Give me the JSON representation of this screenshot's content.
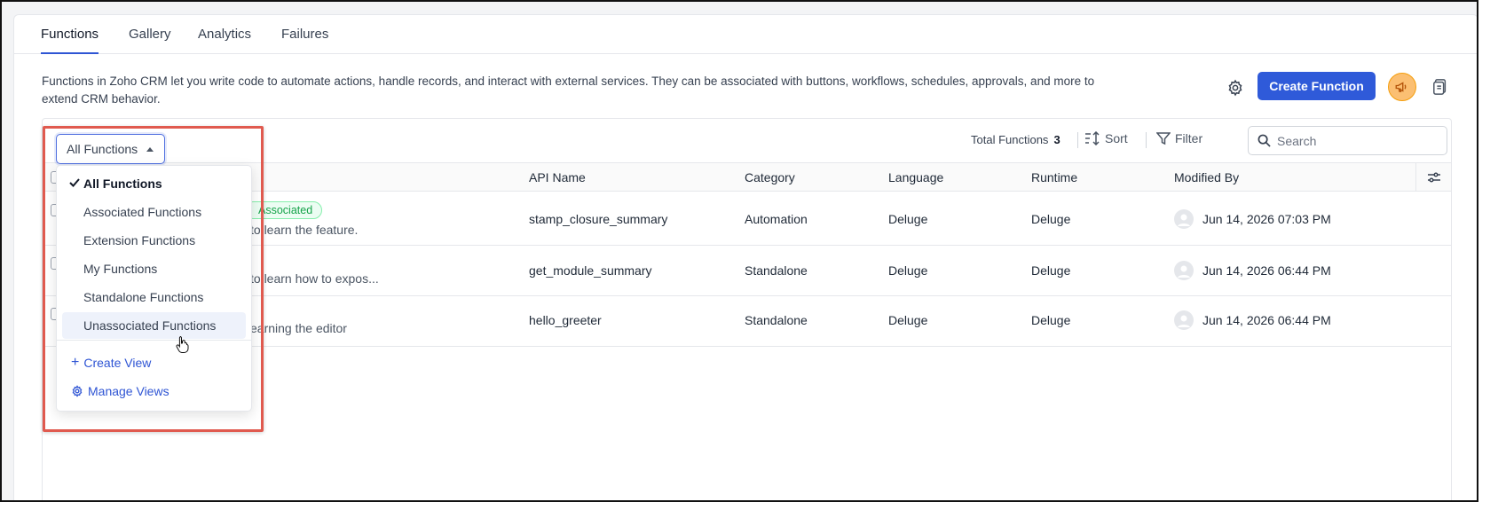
{
  "tabs": [
    {
      "label": "Functions",
      "active": true
    },
    {
      "label": "Gallery"
    },
    {
      "label": "Analytics"
    },
    {
      "label": "Failures"
    }
  ],
  "description": {
    "line1": "Functions in Zoho CRM let you write code to automate actions, handle records, and interact with external services. They can be associated with buttons, workflows, schedules, approvals, and more to",
    "line2": "extend CRM behavior."
  },
  "header_actions": {
    "create_label": "Create Function",
    "accent": "#2f5ad9",
    "icons": [
      "gear-icon",
      "megaphone-icon",
      "document-icon"
    ]
  },
  "view_selector": {
    "label": "All Functions",
    "options": [
      {
        "label": "All Functions",
        "selected": true
      },
      {
        "label": "Associated Functions"
      },
      {
        "label": "Extension Functions"
      },
      {
        "label": "My Functions"
      },
      {
        "label": "Standalone Functions"
      },
      {
        "label": "Unassociated Functions",
        "hover": true
      }
    ],
    "links": {
      "create_view": "Create View",
      "manage_views": "Manage Views"
    }
  },
  "toolbar": {
    "total_label": "Total Functions",
    "total_count": "3",
    "sort_label": "Sort",
    "filter_label": "Filter",
    "search_placeholder": "Search"
  },
  "table": {
    "columns": [
      "API Name",
      "Category",
      "Language",
      "Runtime",
      "Modified By"
    ],
    "rows": [
      {
        "tag": "Associated",
        "desc_fragment": "to learn the feature.",
        "api_name": "stamp_closure_summary",
        "category": "Automation",
        "language": "Deluge",
        "runtime": "Deluge",
        "modified": "Jun 14, 2026 07:03 PM"
      },
      {
        "tag": "",
        "desc_fragment": "to learn how to expos...",
        "api_name": "get_module_summary",
        "category": "Standalone",
        "language": "Deluge",
        "runtime": "Deluge",
        "modified": "Jun 14, 2026 06:44 PM"
      },
      {
        "tag": "",
        "desc_fragment": "earning the editor",
        "api_name": "hello_greeter",
        "category": "Standalone",
        "language": "Deluge",
        "runtime": "Deluge",
        "modified": "Jun 14, 2026 06:44 PM"
      }
    ]
  }
}
